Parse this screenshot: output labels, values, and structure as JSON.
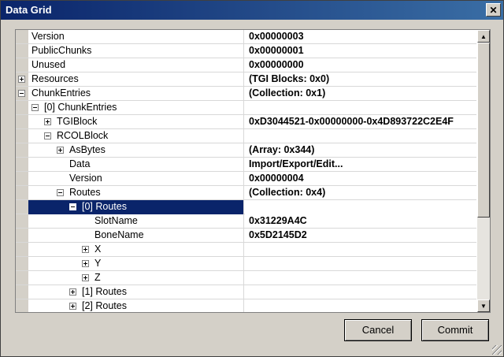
{
  "window": {
    "title": "Data Grid",
    "close_glyph": "✕"
  },
  "grid": {
    "rows": [
      {
        "label": "Version",
        "value": "0x00000003",
        "depth": 0,
        "expander": ""
      },
      {
        "label": "PublicChunks",
        "value": "0x00000001",
        "depth": 0,
        "expander": ""
      },
      {
        "label": "Unused",
        "value": "0x00000000",
        "depth": 0,
        "expander": ""
      },
      {
        "label": "Resources",
        "value": "(TGI Blocks: 0x0)",
        "depth": 0,
        "expander": "plus"
      },
      {
        "label": "ChunkEntries",
        "value": "(Collection: 0x1)",
        "depth": 0,
        "expander": "minus"
      },
      {
        "label": "[0] ChunkEntries",
        "value": "",
        "depth": 1,
        "expander": "minus"
      },
      {
        "label": "TGIBlock",
        "value": "0xD3044521-0x00000000-0x4D893722C2E4F",
        "depth": 2,
        "expander": "plus"
      },
      {
        "label": "RCOLBlock",
        "value": "",
        "depth": 2,
        "expander": "minus"
      },
      {
        "label": "AsBytes",
        "value": "(Array: 0x344)",
        "depth": 3,
        "expander": "plus"
      },
      {
        "label": "Data",
        "value": "Import/Export/Edit...",
        "depth": 3,
        "expander": ""
      },
      {
        "label": "Version",
        "value": "0x00000004",
        "depth": 3,
        "expander": ""
      },
      {
        "label": "Routes",
        "value": "(Collection: 0x4)",
        "depth": 3,
        "expander": "minus"
      },
      {
        "label": "[0] Routes",
        "value": "",
        "depth": 4,
        "expander": "minus",
        "selected": true
      },
      {
        "label": "SlotName",
        "value": "0x31229A4C",
        "depth": 5,
        "expander": ""
      },
      {
        "label": "BoneName",
        "value": "0x5D2145D2",
        "depth": 5,
        "expander": ""
      },
      {
        "label": "X",
        "value": "",
        "depth": 5,
        "expander": "plus"
      },
      {
        "label": "Y",
        "value": "",
        "depth": 5,
        "expander": "plus"
      },
      {
        "label": "Z",
        "value": "",
        "depth": 5,
        "expander": "plus"
      },
      {
        "label": "[1] Routes",
        "value": "",
        "depth": 4,
        "expander": "plus"
      },
      {
        "label": "[2] Routes",
        "value": "",
        "depth": 4,
        "expander": "plus"
      }
    ]
  },
  "scrollbar": {
    "up_glyph": "▲",
    "down_glyph": "▼"
  },
  "buttons": {
    "cancel": "Cancel",
    "commit": "Commit"
  },
  "colors": {
    "selection": "#0a246a",
    "title_start": "#0a246a",
    "title_end": "#3a6ea5"
  }
}
